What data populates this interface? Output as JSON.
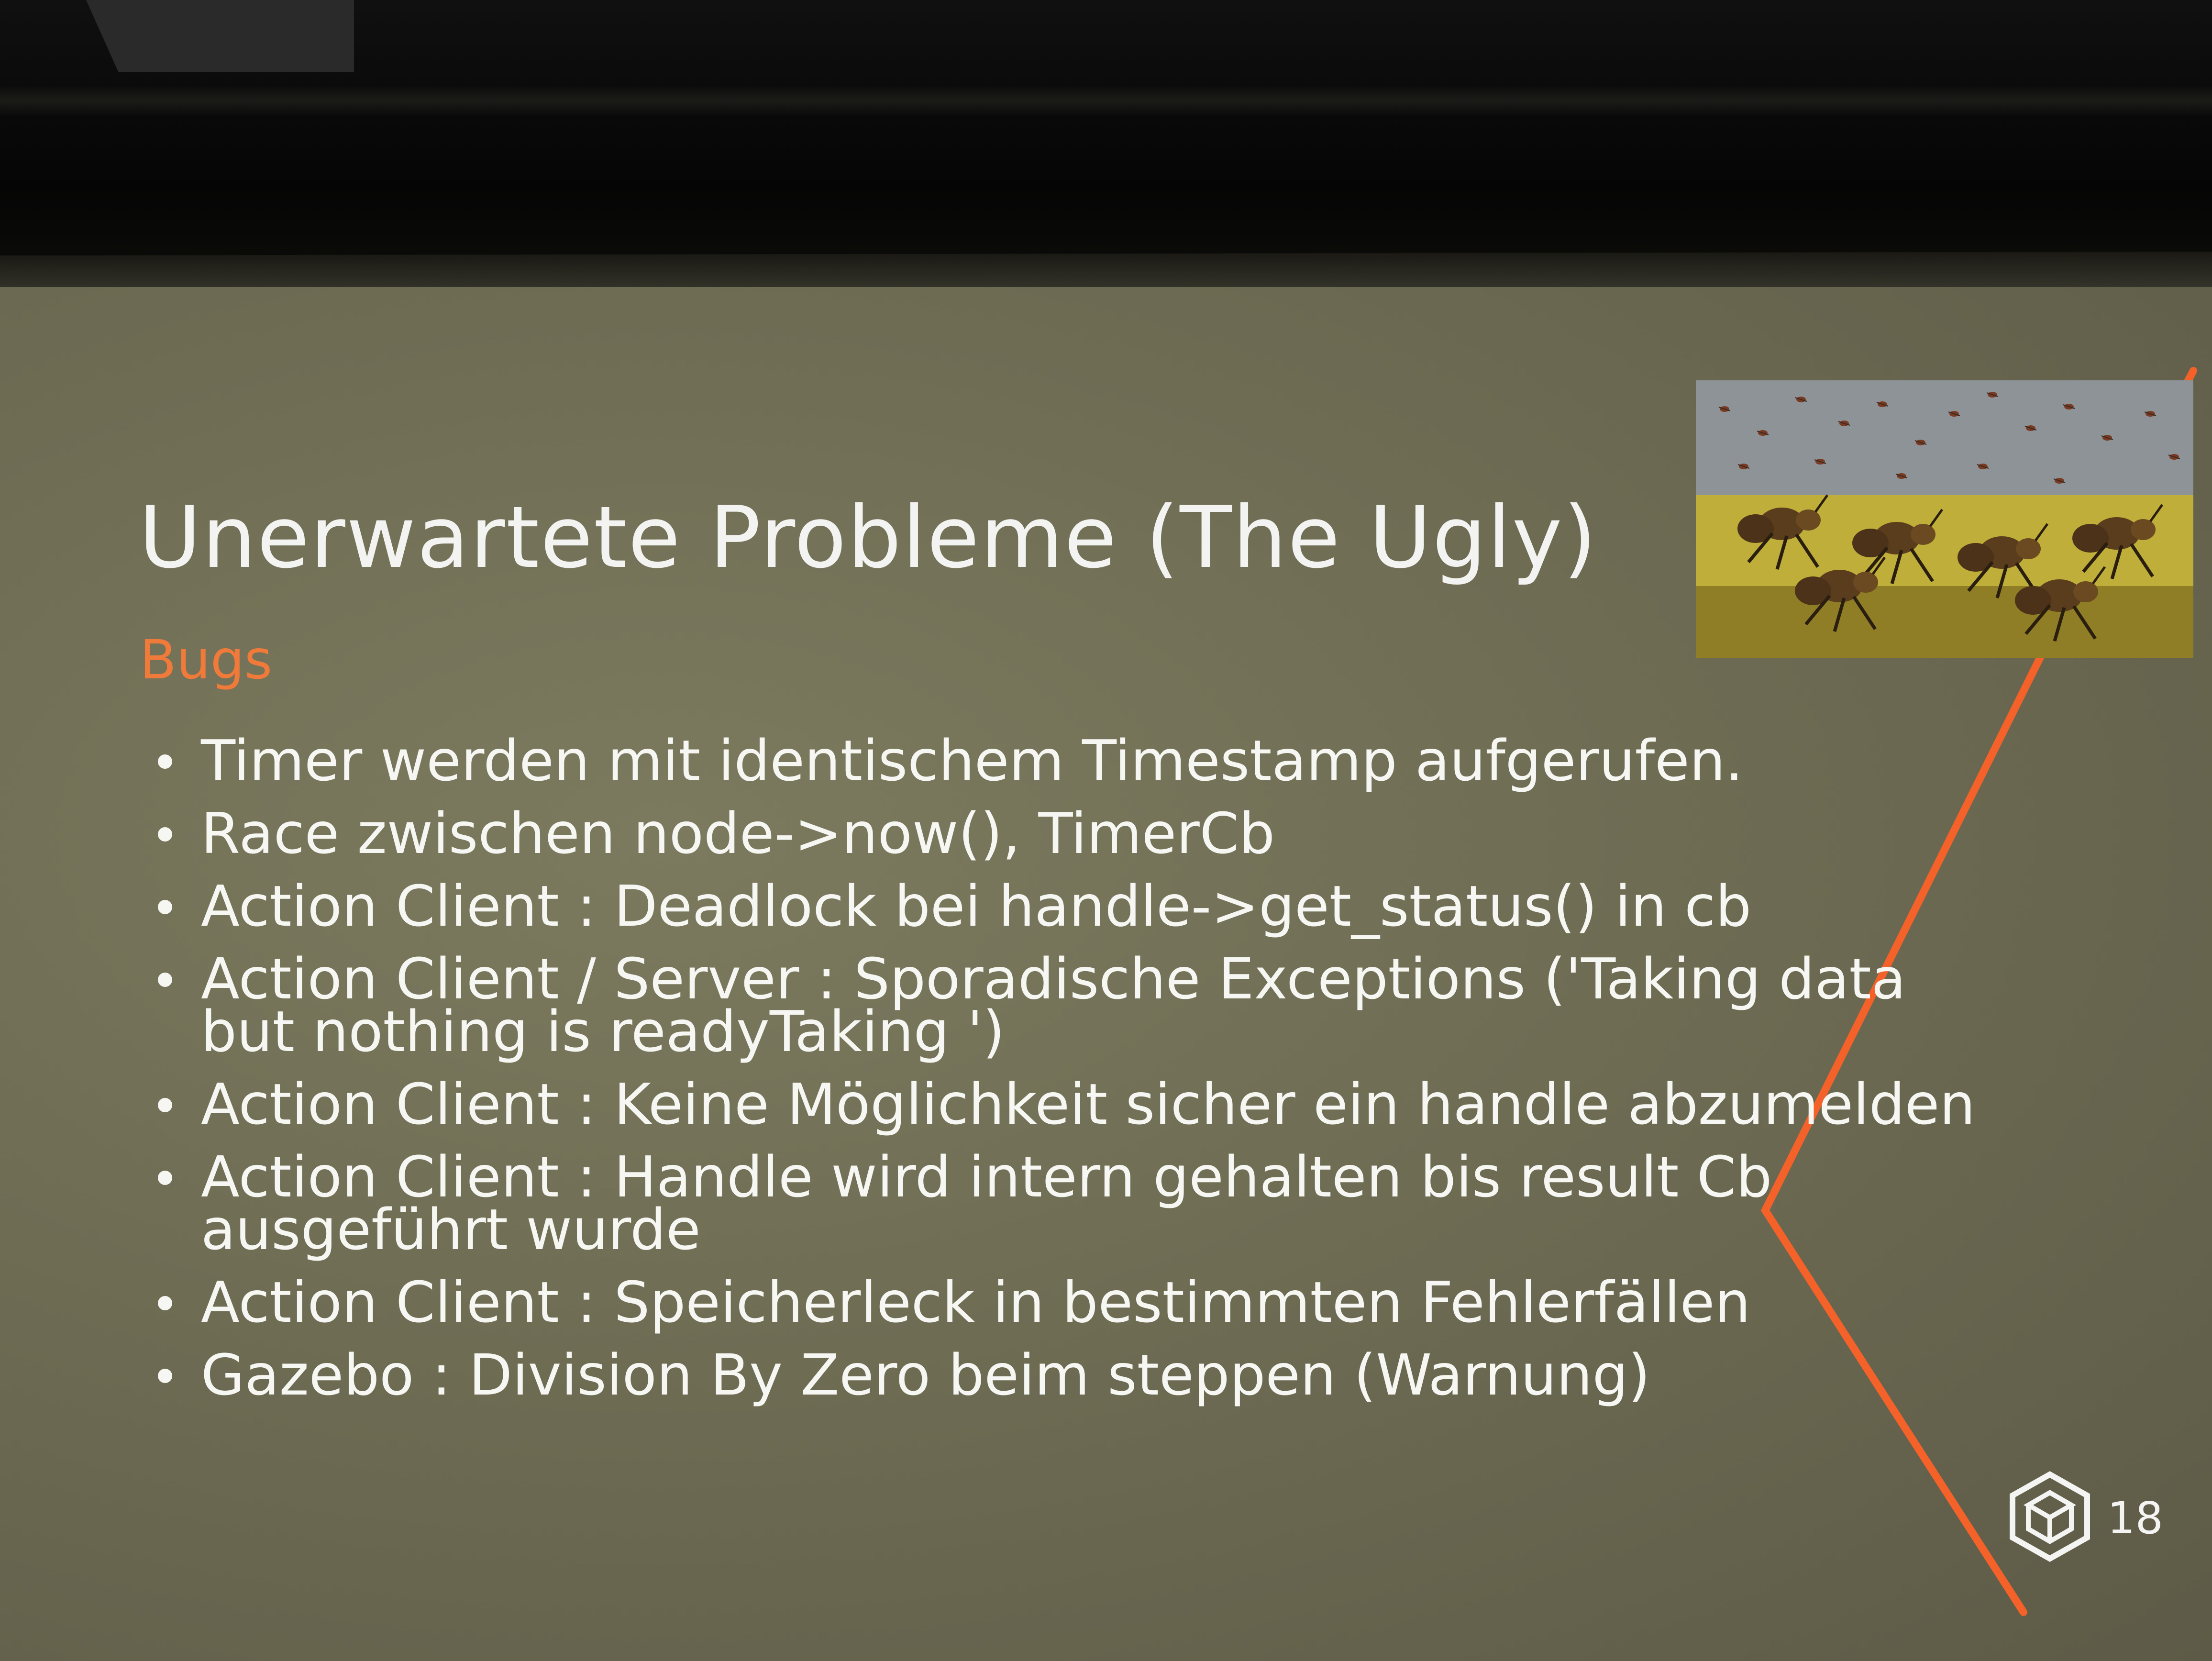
{
  "slide": {
    "title": "Unerwartete Probleme (The Ugly)",
    "subtitle": "Bugs",
    "page_number": "18",
    "accent_color": "#f07a3a",
    "bullets": [
      "Timer werden mit identischem Timestamp aufgerufen.",
      "Race zwischen node->now(), TimerCb",
      "Action Client : Deadlock bei handle->get_status() in cb",
      "Action Client / Server : Sporadische Exceptions ('Taking data\nbut nothing is readyTaking ')",
      "Action Client : Keine Möglichkeit sicher ein handle abzumelden",
      "Action Client : Handle wird intern gehalten bis result Cb\nausgeführt wurde",
      "Action Client : Speicherleck in bestimmten Fehlerfällen",
      "Gazebo : Division By Zero beim steppen (Warnung)"
    ],
    "image": {
      "icon": "giant-ants-illustration"
    },
    "logo": {
      "icon": "hexagon-cube-logo-icon"
    }
  }
}
